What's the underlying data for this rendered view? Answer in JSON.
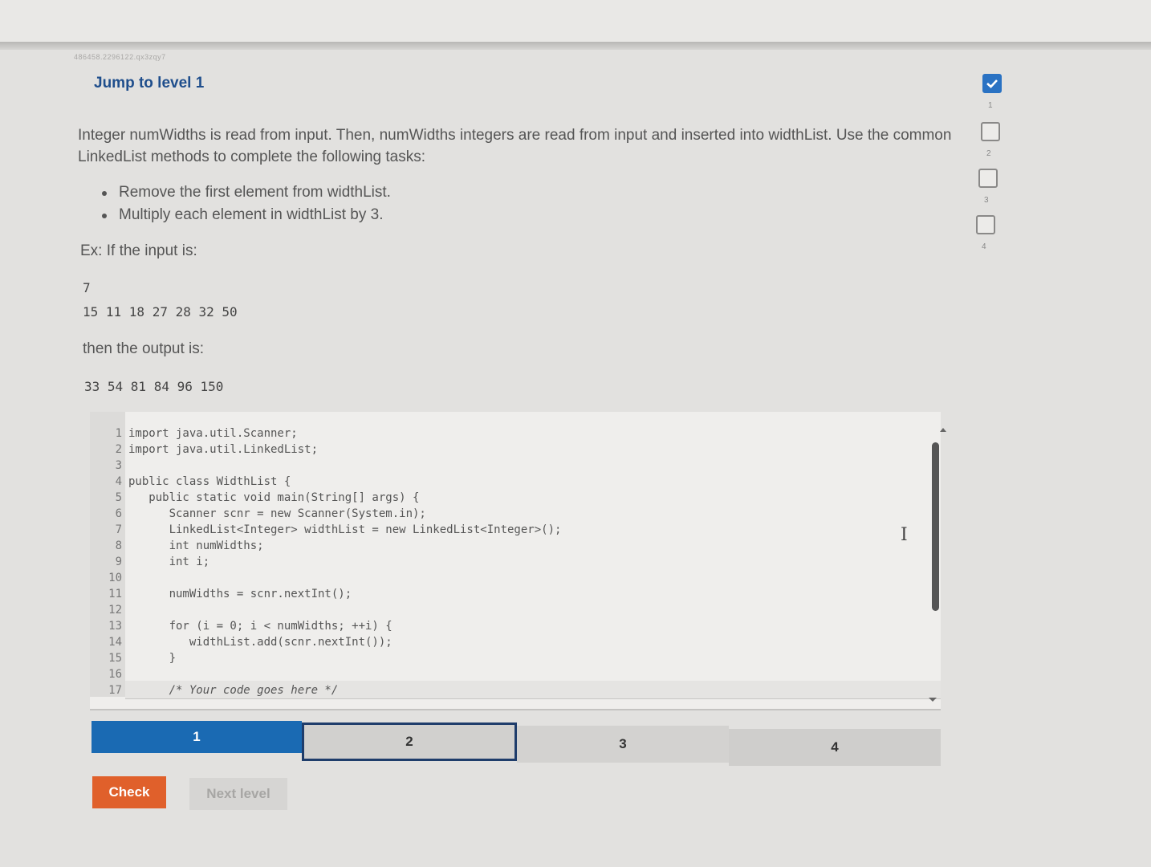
{
  "header": {
    "activity_id": "486458.2296122.qx3zqy7",
    "jump_title": "Jump to level 1"
  },
  "instructions": {
    "text": "Integer numWidths is read from input. Then, numWidths integers are read from input and inserted into widthList. Use the common LinkedList methods to complete the following tasks:",
    "tasks": [
      "Remove the first element from widthList.",
      "Multiply each element in widthList by 3."
    ]
  },
  "example": {
    "input_label": "Ex: If the input is:",
    "input_lines": [
      "7",
      "15 11 18 27 28 32 50"
    ],
    "output_label": "then the output is:",
    "output_line": "33 54 81 84 96 150"
  },
  "code": {
    "lines": [
      {
        "n": "1",
        "text": "import java.util.Scanner;"
      },
      {
        "n": "2",
        "text": "import java.util.LinkedList;"
      },
      {
        "n": "3",
        "text": ""
      },
      {
        "n": "4",
        "text": "public class WidthList {"
      },
      {
        "n": "5",
        "text": "   public static void main(String[] args) {"
      },
      {
        "n": "6",
        "text": "      Scanner scnr = new Scanner(System.in);"
      },
      {
        "n": "7",
        "text": "      LinkedList<Integer> widthList = new LinkedList<Integer>();"
      },
      {
        "n": "8",
        "text": "      int numWidths;"
      },
      {
        "n": "9",
        "text": "      int i;"
      },
      {
        "n": "10",
        "text": ""
      },
      {
        "n": "11",
        "text": "      numWidths = scnr.nextInt();"
      },
      {
        "n": "12",
        "text": ""
      },
      {
        "n": "13",
        "text": "      for (i = 0; i < numWidths; ++i) {"
      },
      {
        "n": "14",
        "text": "         widthList.add(scnr.nextInt());"
      },
      {
        "n": "15",
        "text": "      }"
      },
      {
        "n": "16",
        "text": ""
      },
      {
        "n": "17",
        "text": "      /* Your code goes here */"
      }
    ]
  },
  "levels": {
    "items": [
      {
        "label": "1",
        "state": "current"
      },
      {
        "label": "2",
        "state": "selected"
      },
      {
        "label": "3",
        "state": "locked"
      },
      {
        "label": "4",
        "state": "locked"
      }
    ],
    "side_numbers": [
      "1",
      "2",
      "3",
      "4"
    ]
  },
  "buttons": {
    "check": "Check",
    "next_level": "Next level"
  },
  "colors": {
    "accent_blue": "#1a6ab3",
    "check_orange": "#e0602b",
    "title_blue": "#1f4e8c"
  }
}
